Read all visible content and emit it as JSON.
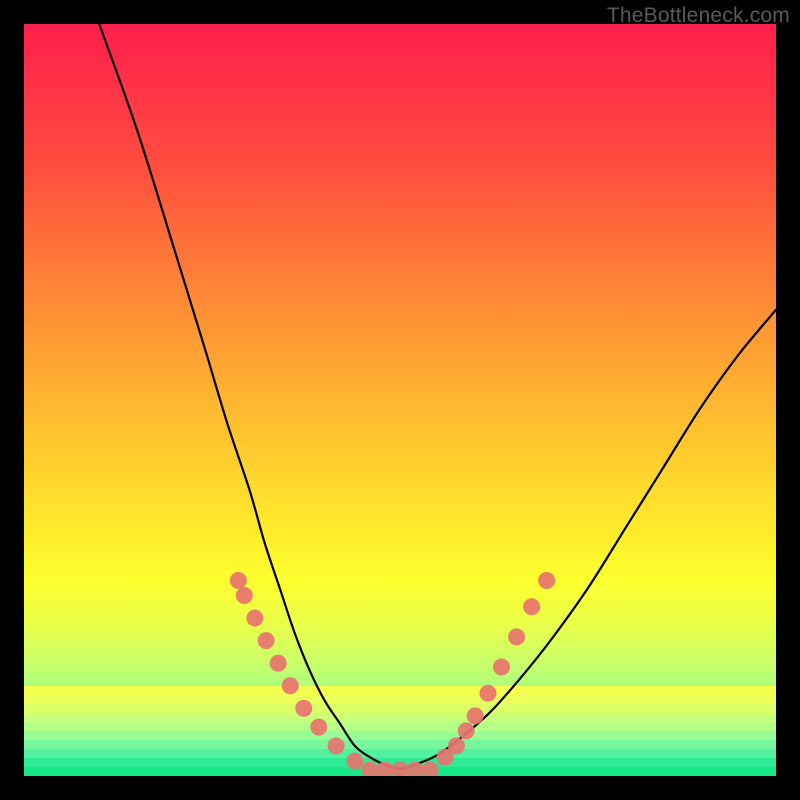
{
  "watermark": "TheBottleneck.com",
  "chart_data": {
    "type": "line",
    "title": "",
    "xlabel": "",
    "ylabel": "",
    "xlim": [
      0,
      100
    ],
    "ylim": [
      0,
      100
    ],
    "series": [
      {
        "name": "curve",
        "color": "#000000",
        "x": [
          10,
          15,
          20,
          24,
          27,
          30,
          32,
          34,
          36,
          38,
          40,
          42,
          44,
          46,
          48,
          50,
          52,
          55,
          58,
          62,
          66,
          70,
          75,
          80,
          85,
          90,
          95,
          100
        ],
        "y": [
          100,
          86,
          70,
          57,
          47,
          38,
          31,
          25,
          19,
          14,
          10,
          7,
          4,
          2.5,
          1.5,
          1,
          1.5,
          2.8,
          5,
          8.5,
          13,
          18,
          25,
          33,
          41,
          49,
          56,
          62
        ]
      },
      {
        "name": "markers-left",
        "type": "scatter",
        "color": "#e8736f",
        "x": [
          28.5,
          29.3,
          30.7,
          32.2,
          33.8,
          35.4,
          37.2,
          39.2,
          41.5,
          44.0
        ],
        "y": [
          26.0,
          24.0,
          21.0,
          18.0,
          15.0,
          12.0,
          9.0,
          6.5,
          4.0,
          2.0
        ]
      },
      {
        "name": "markers-bottom",
        "type": "scatter",
        "color": "#e8736f",
        "x": [
          46.0,
          48.0,
          50.0,
          52.0,
          54.0
        ],
        "y": [
          0.8,
          0.8,
          0.8,
          0.8,
          0.8
        ]
      },
      {
        "name": "markers-right",
        "type": "scatter",
        "color": "#e8736f",
        "x": [
          56.0,
          57.5,
          58.8,
          60.0,
          61.7,
          63.5,
          65.5,
          67.5,
          69.5
        ],
        "y": [
          2.5,
          4.0,
          6.0,
          8.0,
          11.0,
          14.5,
          18.5,
          22.5,
          26.0
        ]
      }
    ],
    "gradient_stops": [
      {
        "pct": 0,
        "color": "#ff1f4a"
      },
      {
        "pct": 18,
        "color": "#ff4b3f"
      },
      {
        "pct": 44,
        "color": "#ffa232"
      },
      {
        "pct": 66,
        "color": "#ffe72c"
      },
      {
        "pct": 85,
        "color": "#c9ff6a"
      },
      {
        "pct": 100,
        "color": "#17e887"
      }
    ],
    "bottom_bands": [
      "#f4ff4e",
      "#eaff5a",
      "#dcff68",
      "#caff78",
      "#b4ff88",
      "#98fd94",
      "#76f79c",
      "#52f19f",
      "#2eea95",
      "#17e887"
    ]
  }
}
